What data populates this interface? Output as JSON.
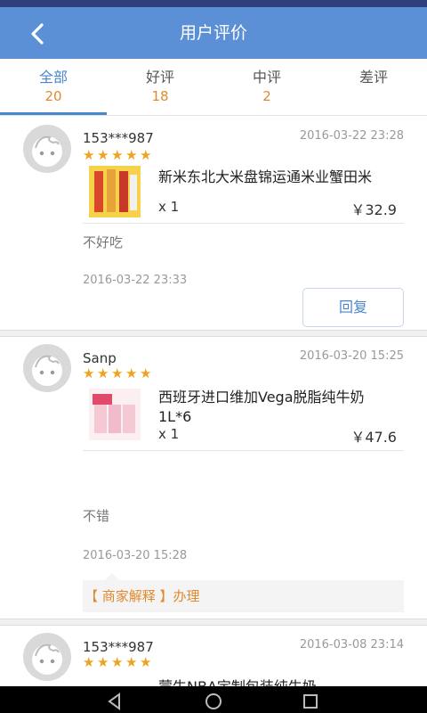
{
  "header": {
    "title": "用户评价"
  },
  "tabs": [
    {
      "label": "全部",
      "count": "20"
    },
    {
      "label": "好评",
      "count": "18"
    },
    {
      "label": "中评",
      "count": "2"
    },
    {
      "label": "差评",
      "count": ""
    }
  ],
  "reviews": [
    {
      "user": "153***987",
      "date": "2016-03-22 23:28",
      "rating": 5,
      "product": "新米东北大米盘锦运通米业蟹田米",
      "qty": "x 1",
      "price": "￥32.9",
      "comment": "不好吃",
      "comment_date": "2016-03-22 23:33",
      "reply_label": "回复"
    },
    {
      "user": "Sanp",
      "date": "2016-03-20 15:25",
      "rating": 5,
      "product": "西班牙进口维加Vega脱脂纯牛奶1L*6",
      "qty": "x 1",
      "price": "￥47.6",
      "comment": "不错",
      "comment_date": "2016-03-20 15:28",
      "merchant_tag": "【 商家解释 】",
      "merchant_reply": "办理"
    },
    {
      "user": "153***987",
      "date": "2016-03-08 23:14",
      "rating": 5,
      "product": "蒙牛NBA定制包装纯牛奶"
    }
  ],
  "colors": {
    "header": "#5b8fd6",
    "accent": "#4a86d0",
    "count": "#e08a2e",
    "star": "#f0a21d"
  },
  "icons": [
    "back-arrow-icon",
    "avatar-face-icon",
    "star-icon",
    "nav-back-icon",
    "nav-home-icon",
    "nav-recent-icon"
  ]
}
